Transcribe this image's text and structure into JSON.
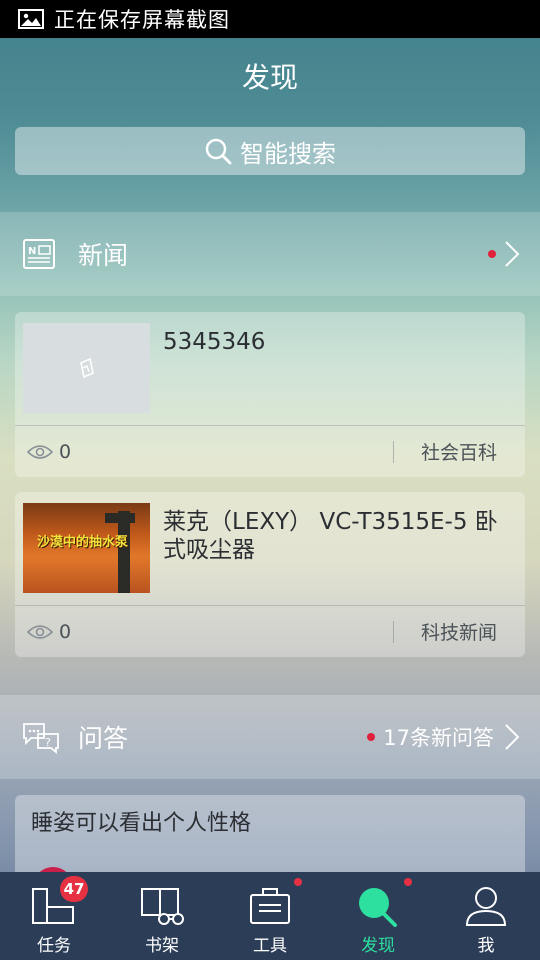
{
  "status_bar": {
    "icon": "image-icon",
    "text": "正在保存屏幕截图"
  },
  "page": {
    "title": "发现"
  },
  "search": {
    "label": "智能搜索",
    "icon": "search-icon"
  },
  "news_section": {
    "title": "新闻",
    "icon": "newspaper-icon",
    "has_new": true
  },
  "news_items": [
    {
      "title": "5345346",
      "views": "0",
      "category": "社会百科",
      "thumb_icon": "placeholder-image-icon"
    },
    {
      "title": "莱克（LEXY） VC-T3515E-5 卧式吸尘器",
      "views": "0",
      "category": "科技新闻",
      "thumb_caption": "沙漠中的抽水泵"
    }
  ],
  "qa_section": {
    "title": "问答",
    "icon": "chat-question-icon",
    "count_text": "17条新问答"
  },
  "qa_items": [
    {
      "title": "睡姿可以看出个人性格"
    }
  ],
  "bottom_nav": [
    {
      "label": "任务",
      "icon": "tasks-icon",
      "badge": "47"
    },
    {
      "label": "书架",
      "icon": "bookshelf-icon"
    },
    {
      "label": "工具",
      "icon": "toolbox-icon",
      "dot": true
    },
    {
      "label": "发现",
      "icon": "discover-search-icon",
      "dot": true,
      "active": true
    },
    {
      "label": "我",
      "icon": "user-icon"
    }
  ],
  "colors": {
    "active": "#2de0a0",
    "badge": "#e53142",
    "nav_bg": "#2c3d57",
    "status_bar": "#000000"
  }
}
